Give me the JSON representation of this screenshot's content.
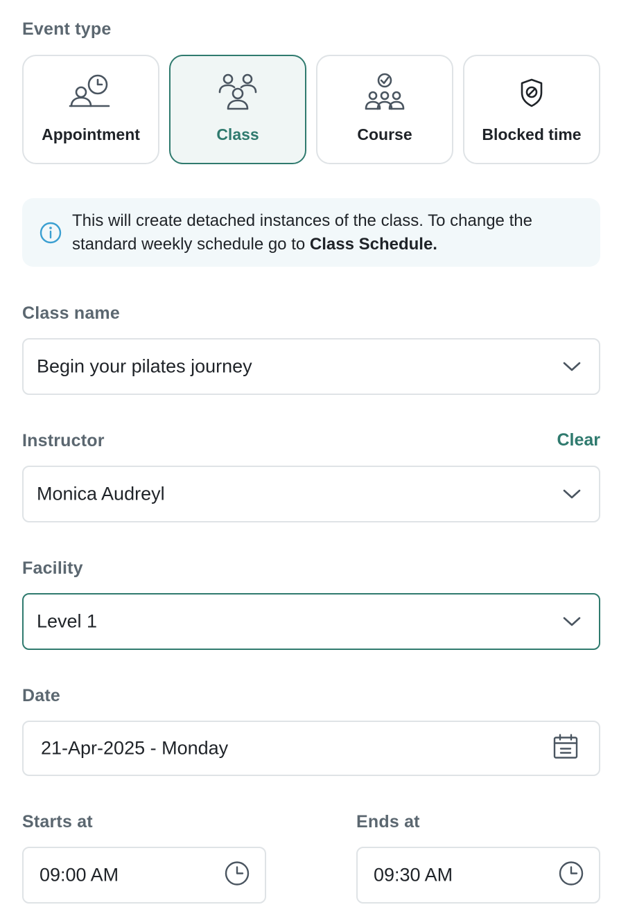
{
  "event_type": {
    "label": "Event type",
    "options": [
      {
        "label": "Appointment",
        "icon": "appointment-icon",
        "selected": false
      },
      {
        "label": "Class",
        "icon": "class-icon",
        "selected": true
      },
      {
        "label": "Course",
        "icon": "course-icon",
        "selected": false
      },
      {
        "label": "Blocked time",
        "icon": "blocked-time-icon",
        "selected": false
      }
    ]
  },
  "info_banner": {
    "text": "This will create detached instances of the class. To change the standard weekly schedule go to ",
    "link_text": "Class Schedule."
  },
  "class_name": {
    "label": "Class name",
    "value": "Begin your pilates journey"
  },
  "instructor": {
    "label": "Instructor",
    "value": "Monica Audreyl",
    "clear_label": "Clear"
  },
  "facility": {
    "label": "Facility",
    "value": "Level 1"
  },
  "date": {
    "label": "Date",
    "value": "21-Apr-2025 - Monday"
  },
  "starts_at": {
    "label": "Starts at",
    "value": "09:00 AM"
  },
  "ends_at": {
    "label": "Ends at",
    "value": "09:30 AM"
  },
  "colors": {
    "accent": "#2f7a6e",
    "selected_card_bg": "#f0f6f5",
    "info_bg": "#f2f8fa",
    "info_icon": "#3a9fd1",
    "label": "#5b6770",
    "border": "#dfe3e6"
  }
}
